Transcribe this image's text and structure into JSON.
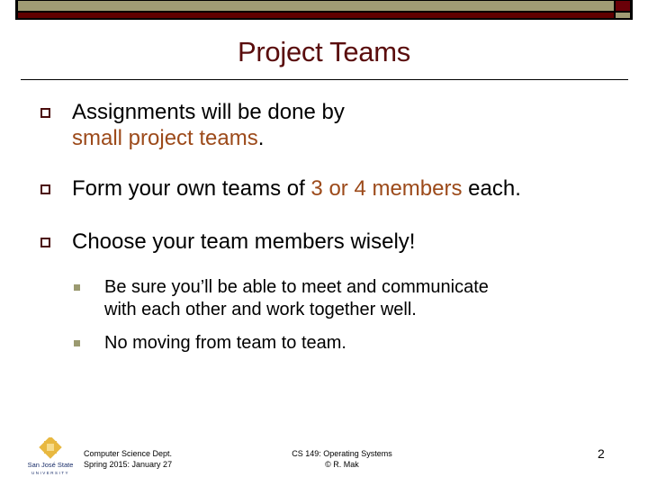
{
  "slide": {
    "title": "Project Teams",
    "bullets": [
      {
        "parts": [
          {
            "text": "Assignments will be done by",
            "highlight": false
          },
          {
            "text": "small project teams",
            "highlight": true
          },
          {
            "text": ".",
            "highlight": false
          }
        ]
      },
      {
        "parts": [
          {
            "text": "Form your own teams of ",
            "highlight": false
          },
          {
            "text": "3 or 4 members",
            "highlight": true
          },
          {
            "text": " each.",
            "highlight": false
          }
        ]
      },
      {
        "parts": [
          {
            "text": "Choose your team members wisely!",
            "highlight": false
          }
        ],
        "sub_bullets": [
          {
            "line1": "Be sure you’ll be able to meet and communicate",
            "line2": "with each other and work together well."
          },
          {
            "line1": "No moving from team to team."
          }
        ]
      }
    ]
  },
  "footer": {
    "logo_name": "San José State",
    "logo_sub": "UNIVERSITY",
    "left_line1": "Computer Science Dept.",
    "left_line2": "Spring 2015: January 27",
    "center_line1": "CS 149: Operating Systems",
    "center_line2": "© R. Mak",
    "page_number": "2"
  },
  "colors": {
    "title": "#5a0d0d",
    "highlight": "#9c4a1a",
    "bar_olive": "#a09c74",
    "bar_red": "#600000"
  }
}
